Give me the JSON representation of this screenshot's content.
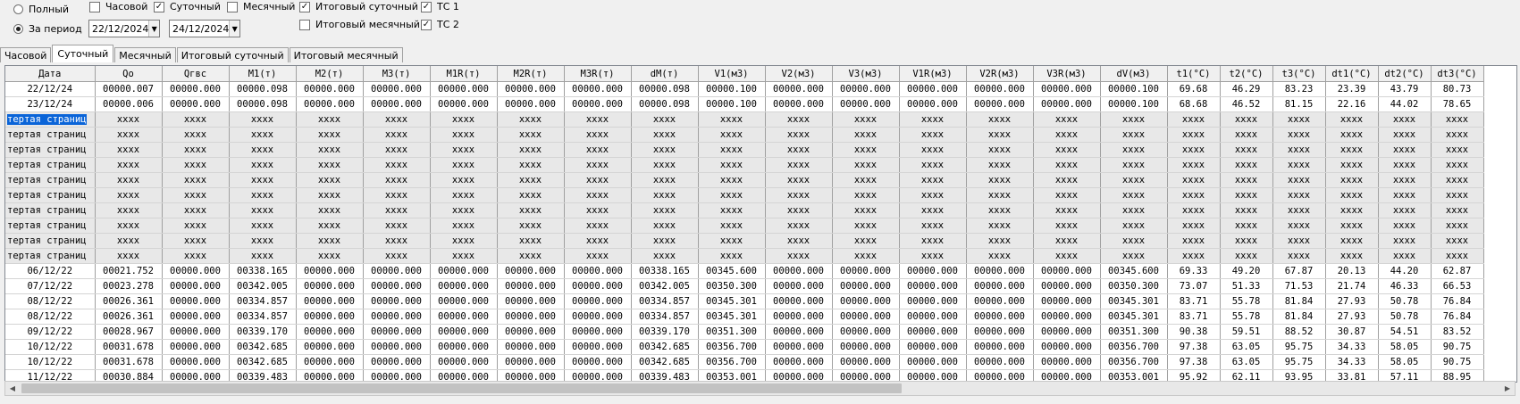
{
  "options": {
    "radio_full": "Полный",
    "radio_period": "За период",
    "date_from": "22/12/2024",
    "date_to": "24/12/2024",
    "chk_hourly": "Часовой",
    "chk_daily": "Суточный",
    "chk_monthly": "Месячный",
    "chk_total_daily": "Итоговый суточный",
    "chk_total_monthly": "Итоговый месячный",
    "chk_ts1": "ТС 1",
    "chk_ts2": "ТС 2"
  },
  "tabs": [
    "Часовой",
    "Суточный",
    "Месячный",
    "Итоговый суточный",
    "Итоговый месячный"
  ],
  "active_tab": "Суточный",
  "grid": {
    "columns": [
      "Дата",
      "Qo",
      "Qгвс",
      "M1(т)",
      "M2(т)",
      "M3(т)",
      "M1R(т)",
      "M2R(т)",
      "M3R(т)",
      "dM(т)",
      "V1(м3)",
      "V2(м3)",
      "V3(м3)",
      "V1R(м3)",
      "V2R(м3)",
      "V3R(м3)",
      "dV(м3)",
      "t1(°C)",
      "t2(°C)",
      "t3(°C)",
      "dt1(°C)",
      "dt2(°C)",
      "dt3(°C)"
    ],
    "rows": [
      [
        "22/12/24",
        "00000.007",
        "00000.000",
        "00000.098",
        "00000.000",
        "00000.000",
        "00000.000",
        "00000.000",
        "00000.000",
        "00000.098",
        "00000.100",
        "00000.000",
        "00000.000",
        "00000.000",
        "00000.000",
        "00000.000",
        "00000.100",
        "69.68",
        "46.29",
        "83.23",
        "23.39",
        "43.79",
        "80.73"
      ],
      [
        "23/12/24",
        "00000.006",
        "00000.000",
        "00000.098",
        "00000.000",
        "00000.000",
        "00000.000",
        "00000.000",
        "00000.000",
        "00000.098",
        "00000.100",
        "00000.000",
        "00000.000",
        "00000.000",
        "00000.000",
        "00000.000",
        "00000.100",
        "68.68",
        "46.52",
        "81.15",
        "22.16",
        "44.02",
        "78.65"
      ],
      [
        "тертая страниц",
        "xxxx",
        "xxxx",
        "xxxx",
        "xxxx",
        "xxxx",
        "xxxx",
        "xxxx",
        "xxxx",
        "xxxx",
        "xxxx",
        "xxxx",
        "xxxx",
        "xxxx",
        "xxxx",
        "xxxx",
        "xxxx",
        "xxxx",
        "xxxx",
        "xxxx",
        "xxxx",
        "xxxx",
        "xxxx"
      ],
      [
        "тертая страниц",
        "xxxx",
        "xxxx",
        "xxxx",
        "xxxx",
        "xxxx",
        "xxxx",
        "xxxx",
        "xxxx",
        "xxxx",
        "xxxx",
        "xxxx",
        "xxxx",
        "xxxx",
        "xxxx",
        "xxxx",
        "xxxx",
        "xxxx",
        "xxxx",
        "xxxx",
        "xxxx",
        "xxxx",
        "xxxx"
      ],
      [
        "тертая страниц",
        "xxxx",
        "xxxx",
        "xxxx",
        "xxxx",
        "xxxx",
        "xxxx",
        "xxxx",
        "xxxx",
        "xxxx",
        "xxxx",
        "xxxx",
        "xxxx",
        "xxxx",
        "xxxx",
        "xxxx",
        "xxxx",
        "xxxx",
        "xxxx",
        "xxxx",
        "xxxx",
        "xxxx",
        "xxxx"
      ],
      [
        "тертая страниц",
        "xxxx",
        "xxxx",
        "xxxx",
        "xxxx",
        "xxxx",
        "xxxx",
        "xxxx",
        "xxxx",
        "xxxx",
        "xxxx",
        "xxxx",
        "xxxx",
        "xxxx",
        "xxxx",
        "xxxx",
        "xxxx",
        "xxxx",
        "xxxx",
        "xxxx",
        "xxxx",
        "xxxx",
        "xxxx"
      ],
      [
        "тертая страниц",
        "xxxx",
        "xxxx",
        "xxxx",
        "xxxx",
        "xxxx",
        "xxxx",
        "xxxx",
        "xxxx",
        "xxxx",
        "xxxx",
        "xxxx",
        "xxxx",
        "xxxx",
        "xxxx",
        "xxxx",
        "xxxx",
        "xxxx",
        "xxxx",
        "xxxx",
        "xxxx",
        "xxxx",
        "xxxx"
      ],
      [
        "тертая страниц",
        "xxxx",
        "xxxx",
        "xxxx",
        "xxxx",
        "xxxx",
        "xxxx",
        "xxxx",
        "xxxx",
        "xxxx",
        "xxxx",
        "xxxx",
        "xxxx",
        "xxxx",
        "xxxx",
        "xxxx",
        "xxxx",
        "xxxx",
        "xxxx",
        "xxxx",
        "xxxx",
        "xxxx",
        "xxxx"
      ],
      [
        "тертая страниц",
        "xxxx",
        "xxxx",
        "xxxx",
        "xxxx",
        "xxxx",
        "xxxx",
        "xxxx",
        "xxxx",
        "xxxx",
        "xxxx",
        "xxxx",
        "xxxx",
        "xxxx",
        "xxxx",
        "xxxx",
        "xxxx",
        "xxxx",
        "xxxx",
        "xxxx",
        "xxxx",
        "xxxx",
        "xxxx"
      ],
      [
        "тертая страниц",
        "xxxx",
        "xxxx",
        "xxxx",
        "xxxx",
        "xxxx",
        "xxxx",
        "xxxx",
        "xxxx",
        "xxxx",
        "xxxx",
        "xxxx",
        "xxxx",
        "xxxx",
        "xxxx",
        "xxxx",
        "xxxx",
        "xxxx",
        "xxxx",
        "xxxx",
        "xxxx",
        "xxxx",
        "xxxx"
      ],
      [
        "тертая страниц",
        "xxxx",
        "xxxx",
        "xxxx",
        "xxxx",
        "xxxx",
        "xxxx",
        "xxxx",
        "xxxx",
        "xxxx",
        "xxxx",
        "xxxx",
        "xxxx",
        "xxxx",
        "xxxx",
        "xxxx",
        "xxxx",
        "xxxx",
        "xxxx",
        "xxxx",
        "xxxx",
        "xxxx",
        "xxxx"
      ],
      [
        "тертая страниц",
        "xxxx",
        "xxxx",
        "xxxx",
        "xxxx",
        "xxxx",
        "xxxx",
        "xxxx",
        "xxxx",
        "xxxx",
        "xxxx",
        "xxxx",
        "xxxx",
        "xxxx",
        "xxxx",
        "xxxx",
        "xxxx",
        "xxxx",
        "xxxx",
        "xxxx",
        "xxxx",
        "xxxx",
        "xxxx"
      ],
      [
        "06/12/22",
        "00021.752",
        "00000.000",
        "00338.165",
        "00000.000",
        "00000.000",
        "00000.000",
        "00000.000",
        "00000.000",
        "00338.165",
        "00345.600",
        "00000.000",
        "00000.000",
        "00000.000",
        "00000.000",
        "00000.000",
        "00345.600",
        "69.33",
        "49.20",
        "67.87",
        "20.13",
        "44.20",
        "62.87"
      ],
      [
        "07/12/22",
        "00023.278",
        "00000.000",
        "00342.005",
        "00000.000",
        "00000.000",
        "00000.000",
        "00000.000",
        "00000.000",
        "00342.005",
        "00350.300",
        "00000.000",
        "00000.000",
        "00000.000",
        "00000.000",
        "00000.000",
        "00350.300",
        "73.07",
        "51.33",
        "71.53",
        "21.74",
        "46.33",
        "66.53"
      ],
      [
        "08/12/22",
        "00026.361",
        "00000.000",
        "00334.857",
        "00000.000",
        "00000.000",
        "00000.000",
        "00000.000",
        "00000.000",
        "00334.857",
        "00345.301",
        "00000.000",
        "00000.000",
        "00000.000",
        "00000.000",
        "00000.000",
        "00345.301",
        "83.71",
        "55.78",
        "81.84",
        "27.93",
        "50.78",
        "76.84"
      ],
      [
        "08/12/22",
        "00026.361",
        "00000.000",
        "00334.857",
        "00000.000",
        "00000.000",
        "00000.000",
        "00000.000",
        "00000.000",
        "00334.857",
        "00345.301",
        "00000.000",
        "00000.000",
        "00000.000",
        "00000.000",
        "00000.000",
        "00345.301",
        "83.71",
        "55.78",
        "81.84",
        "27.93",
        "50.78",
        "76.84"
      ],
      [
        "09/12/22",
        "00028.967",
        "00000.000",
        "00339.170",
        "00000.000",
        "00000.000",
        "00000.000",
        "00000.000",
        "00000.000",
        "00339.170",
        "00351.300",
        "00000.000",
        "00000.000",
        "00000.000",
        "00000.000",
        "00000.000",
        "00351.300",
        "90.38",
        "59.51",
        "88.52",
        "30.87",
        "54.51",
        "83.52"
      ],
      [
        "10/12/22",
        "00031.678",
        "00000.000",
        "00342.685",
        "00000.000",
        "00000.000",
        "00000.000",
        "00000.000",
        "00000.000",
        "00342.685",
        "00356.700",
        "00000.000",
        "00000.000",
        "00000.000",
        "00000.000",
        "00000.000",
        "00356.700",
        "97.38",
        "63.05",
        "95.75",
        "34.33",
        "58.05",
        "90.75"
      ],
      [
        "10/12/22",
        "00031.678",
        "00000.000",
        "00342.685",
        "00000.000",
        "00000.000",
        "00000.000",
        "00000.000",
        "00000.000",
        "00342.685",
        "00356.700",
        "00000.000",
        "00000.000",
        "00000.000",
        "00000.000",
        "00000.000",
        "00356.700",
        "97.38",
        "63.05",
        "95.75",
        "34.33",
        "58.05",
        "90.75"
      ],
      [
        "11/12/22",
        "00030.884",
        "00000.000",
        "00339.483",
        "00000.000",
        "00000.000",
        "00000.000",
        "00000.000",
        "00000.000",
        "00339.483",
        "00353.001",
        "00000.000",
        "00000.000",
        "00000.000",
        "00000.000",
        "00000.000",
        "00353.001",
        "95.92",
        "62.11",
        "93.95",
        "33.81",
        "57.11",
        "88.95"
      ]
    ]
  }
}
